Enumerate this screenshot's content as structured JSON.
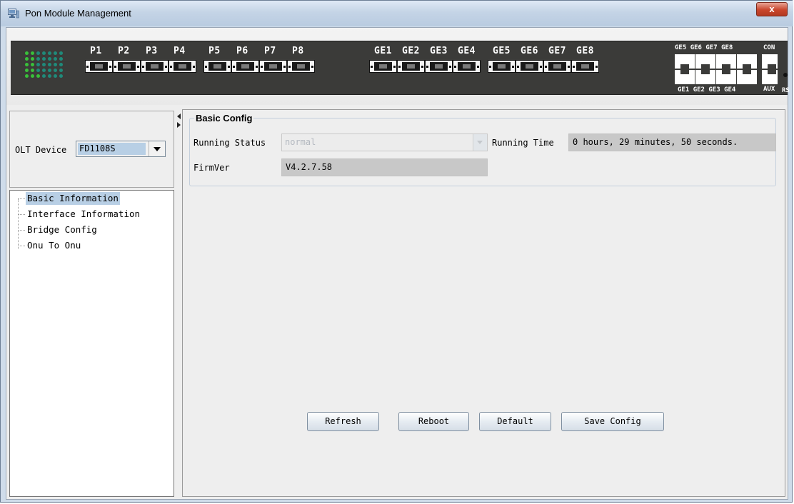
{
  "window": {
    "title": "Pon Module Management",
    "close_label": "x",
    "title_icon": "window-app-icon"
  },
  "device_panel": {
    "pon_ports": [
      "P1",
      "P2",
      "P3",
      "P4",
      "P5",
      "P6",
      "P7",
      "P8"
    ],
    "ge_sfp_ports": [
      "GE1",
      "GE2",
      "GE3",
      "GE4",
      "GE5",
      "GE6",
      "GE7",
      "GE8"
    ],
    "rj45_top_labels": [
      "GE5",
      "GE6",
      "GE7",
      "GE8"
    ],
    "rj45_bottom_labels": [
      "GE1",
      "GE2",
      "GE3",
      "GE4"
    ],
    "con_label": "CON",
    "aux_label": "AUX",
    "rs_label": "RS",
    "led_active_color": "#39c13a",
    "led_idle_color": "#1f8a7a"
  },
  "sidebar": {
    "olt_label": "OLT Device",
    "olt_value": "FD1108S",
    "tree": [
      {
        "label": "Basic Information",
        "selected": true
      },
      {
        "label": "Interface Information",
        "selected": false
      },
      {
        "label": "Bridge Config",
        "selected": false
      },
      {
        "label": "Onu To Onu",
        "selected": false
      }
    ]
  },
  "basic_config": {
    "title": "Basic Config",
    "running_status_label": "Running Status",
    "running_status_value": "normal",
    "running_time_label": "Running Time",
    "running_time_value": "0 hours, 29 minutes, 50 seconds.",
    "firmver_label": "FirmVer",
    "firmver_value": "V4.2.7.58"
  },
  "buttons": {
    "refresh": "Refresh",
    "reboot": "Reboot",
    "default": "Default",
    "save": "Save Config"
  }
}
